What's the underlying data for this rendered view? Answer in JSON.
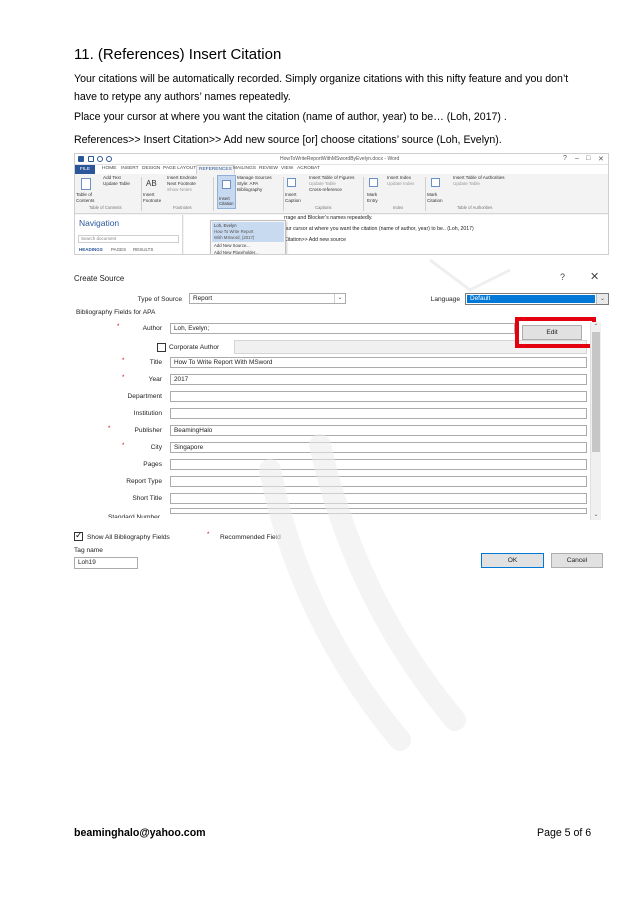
{
  "heading": "11. (References) Insert Citation",
  "paragraphs": {
    "p1": "Your citations will be automatically recorded. Simply organize citations with this nifty feature and you don’t have to retype any authors’ names repeatedly.",
    "p2": "Place your cursor at where you want the citation (name of author, year) to be… (Loh, 2017) .",
    "p3": "References>> Insert Citation>> Add new source [or] choose citations’ source (Loh, Evelyn)."
  },
  "word": {
    "doc_title": "HowToWriteReportWithMSwordByEvelyn.docx - Word",
    "tabs": [
      "FILE",
      "HOME",
      "INSERT",
      "DESIGN",
      "PAGE LAYOUT",
      "REFERENCES",
      "MAILINGS",
      "REVIEW",
      "VIEW",
      "ACROBAT"
    ],
    "ribbon": {
      "add_text": "Add Text",
      "update_table": "Update Table",
      "table_of_contents": "Table of Contents",
      "ab_label": "AB",
      "insert_endnote": "Insert Endnote",
      "next_footnote": "Next Footnote",
      "show_notes": "Show Notes",
      "insert_footnote": "Insert Footnote",
      "manage_sources": "Manage Sources",
      "style_label": "Style: APA",
      "bibliography": "Bibliography",
      "insert_citation": "Insert Citation",
      "insert_table_of_figures": "Insert Table of Figures",
      "update_table_2": "Update Table",
      "cross_reference": "Cross-reference",
      "insert_caption": "Insert Caption",
      "insert_index": "Insert Index",
      "update_index": "Update Index",
      "mark_entry": "Mark Entry",
      "insert_table_of_authorities": "Insert Table of Authorities",
      "update_table_3": "Update Table",
      "mark_citation": "Mark Citation",
      "grp_toc": "Table of Contents",
      "grp_footnotes": "Footnotes",
      "grp_captions": "Captions",
      "grp_index": "Index",
      "grp_authorities": "Table of Authorities"
    },
    "nav": {
      "title": "Navigation",
      "search_placeholder": "Search document",
      "tab_headings": "HEADINGS",
      "tab_pages": "PAGES",
      "tab_results": "RESULTS"
    },
    "dropdown": {
      "item1": "Loh, Evelyn",
      "item2": "How To Write Report",
      "item3": "With MSword, (2017)",
      "add_source": "Add New Source...",
      "add_placeholder": "Add New Placeholder..."
    },
    "doc_lines": {
      "l1": "rrage and Blocker’s names repeatedly.",
      "l2": "our cursor at where you want the citation (name of author, year) to be.. (Loh, 2017)",
      "l3": "Citation>> Add new source"
    }
  },
  "dialog": {
    "title": "Create Source",
    "help": "?",
    "close": "✕",
    "type_of_source_label": "Type of Source",
    "type_of_source_value": "Report",
    "language_label": "Language",
    "language_value": "Default",
    "bib_fields_label": "Bibliography Fields for APA",
    "edit_label": "Edit",
    "corporate_author_label": "Corporate Author",
    "fields": [
      {
        "label": "Author",
        "value": "Loh, Evelyn;",
        "required": true
      },
      {
        "label": "Title",
        "value": "How To Write Report With MSword",
        "required": true
      },
      {
        "label": "Year",
        "value": "2017",
        "required": true
      },
      {
        "label": "Department",
        "value": "",
        "required": false
      },
      {
        "label": "Institution",
        "value": "",
        "required": false
      },
      {
        "label": "Publisher",
        "value": "BeamingHalo",
        "required": true
      },
      {
        "label": "City",
        "value": "Singapore",
        "required": true
      },
      {
        "label": "Pages",
        "value": "",
        "required": false
      },
      {
        "label": "Report Type",
        "value": "",
        "required": false
      },
      {
        "label": "Short Title",
        "value": "",
        "required": false
      },
      {
        "label": "Standard Number",
        "value": "",
        "required": false
      }
    ],
    "show_all_label": "Show All Bibliography Fields",
    "recommended_label": "Recommended Field",
    "tag_name_label": "Tag name",
    "tag_name_value": "Loh19",
    "ok_label": "OK",
    "cancel_label": "Cancel",
    "star": "*"
  },
  "footer": {
    "email": "beaminghalo@yahoo.com",
    "page": "Page 5  of  6"
  },
  "colors": {
    "highlight_red": "#e3000f",
    "word_blue": "#2b579a",
    "selection_blue": "#0078d7"
  }
}
